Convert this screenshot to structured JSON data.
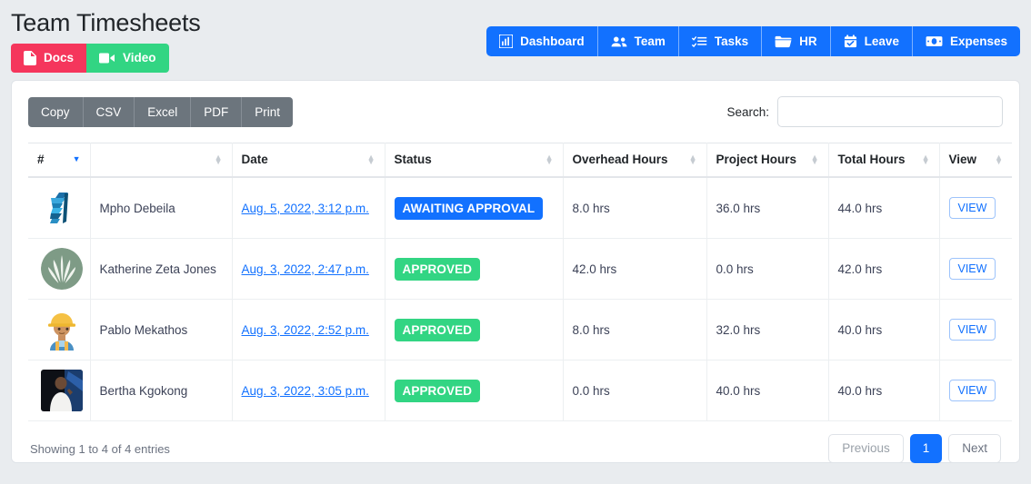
{
  "header": {
    "title": "Team Timesheets",
    "buttons": [
      {
        "label": "Docs",
        "icon": "file-document-icon",
        "color": "#f5365c"
      },
      {
        "label": "Video",
        "icon": "video-camera-icon",
        "color": "#32d583"
      }
    ]
  },
  "nav": {
    "accent": "#1271ff",
    "items": [
      {
        "label": "Dashboard",
        "icon": "chart-bar-icon"
      },
      {
        "label": "Team",
        "icon": "users-icon"
      },
      {
        "label": "Tasks",
        "icon": "list-check-icon"
      },
      {
        "label": "HR",
        "icon": "folder-icon"
      },
      {
        "label": "Leave",
        "icon": "calendar-check-icon"
      },
      {
        "label": "Expenses",
        "icon": "money-bill-icon"
      }
    ]
  },
  "toolbar": {
    "export_buttons": [
      "Copy",
      "CSV",
      "Excel",
      "PDF",
      "Print"
    ],
    "search_label": "Search:",
    "search_value": "",
    "search_placeholder": ""
  },
  "table": {
    "columns": [
      {
        "label": "#",
        "sort": "desc"
      },
      {
        "label": "",
        "sort": "both"
      },
      {
        "label": "Date",
        "sort": "both"
      },
      {
        "label": "Status",
        "sort": "both"
      },
      {
        "label": "Overhead Hours",
        "sort": "both"
      },
      {
        "label": "Project Hours",
        "sort": "both"
      },
      {
        "label": "Total Hours",
        "sort": "both"
      },
      {
        "label": "View",
        "sort": "both"
      }
    ],
    "rows": [
      {
        "avatar": "logo-3d-blue-avatar",
        "name": "Mpho Debeila",
        "date": "Aug. 5, 2022, 3:12 p.m.",
        "status": "AWAITING APPROVAL",
        "status_type": "pending",
        "overhead_hours": "8.0 hrs",
        "project_hours": "36.0 hrs",
        "total_hours": "44.0 hrs",
        "view_label": "VIEW"
      },
      {
        "avatar": "aloe-plant-circle-avatar",
        "name": "Katherine Zeta Jones",
        "date": "Aug. 3, 2022, 2:47 p.m.",
        "status": "APPROVED",
        "status_type": "approved",
        "overhead_hours": "42.0 hrs",
        "project_hours": "0.0 hrs",
        "total_hours": "42.0 hrs",
        "view_label": "VIEW"
      },
      {
        "avatar": "construction-worker-avatar",
        "name": "Pablo Mekathos",
        "date": "Aug. 3, 2022, 2:52 p.m.",
        "status": "APPROVED",
        "status_type": "approved",
        "overhead_hours": "8.0 hrs",
        "project_hours": "32.0 hrs",
        "total_hours": "40.0 hrs",
        "view_label": "VIEW"
      },
      {
        "avatar": "person-photo-avatar",
        "name": "Bertha Kgokong",
        "date": "Aug. 3, 2022, 3:05 p.m.",
        "status": "APPROVED",
        "status_type": "approved",
        "overhead_hours": "0.0 hrs",
        "project_hours": "40.0 hrs",
        "total_hours": "40.0 hrs",
        "view_label": "VIEW"
      }
    ]
  },
  "footer": {
    "entries_info": "Showing 1 to 4 of 4 entries",
    "previous_label": "Previous",
    "current_page": "1",
    "next_label": "Next"
  }
}
